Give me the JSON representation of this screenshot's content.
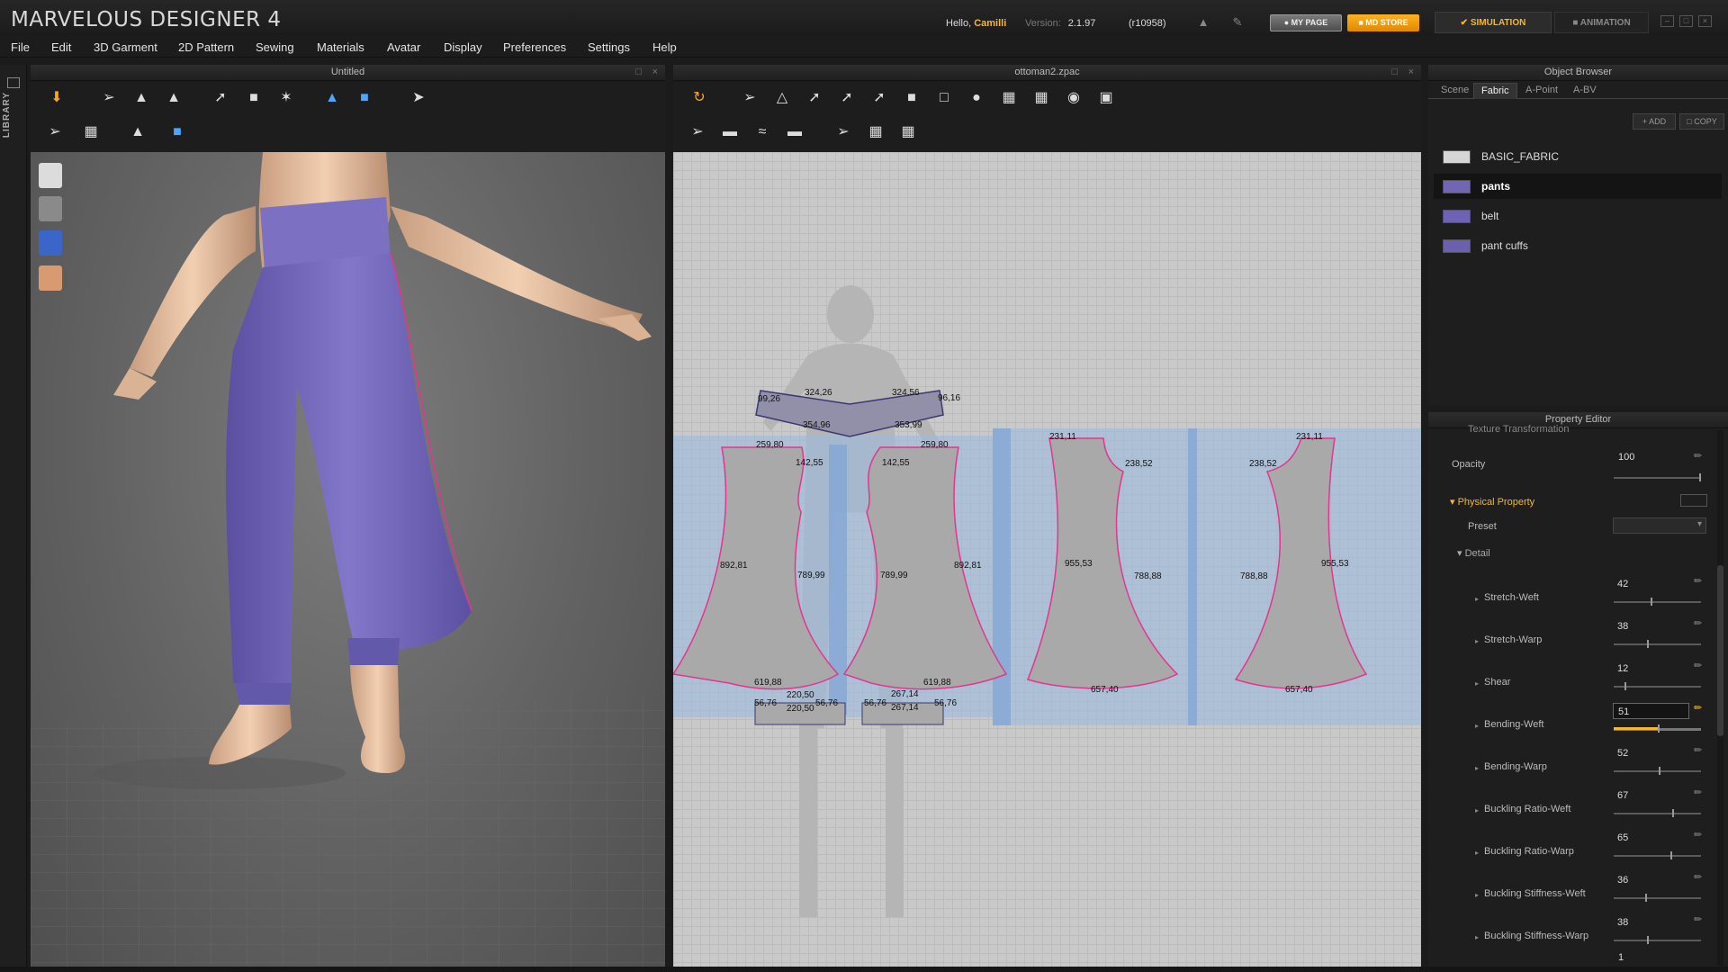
{
  "app": {
    "title": "MARVELOUS DESIGNER 4"
  },
  "header": {
    "hello_label": "Hello,",
    "user_name": "Camilli",
    "version_label": "Version:",
    "version_value": "2.1.97",
    "build": "(r10958)",
    "my_page": "MY PAGE",
    "md_store": "MD STORE",
    "mode_simulation": "SIMULATION",
    "mode_animation": "ANIMATION"
  },
  "menu": [
    "File",
    "Edit",
    "3D Garment",
    "2D Pattern",
    "Sewing",
    "Materials",
    "Avatar",
    "Display",
    "Preferences",
    "Settings",
    "Help"
  ],
  "library_label": "LIBRARY",
  "panels": {
    "view3d_title": "Untitled",
    "view2d_title": "ottoman2.zpac"
  },
  "pattern_labels": [
    "99,26",
    "324,26",
    "324,56",
    "96,16",
    "354,96",
    "353,99",
    "259,80",
    "142,55",
    "142,55",
    "259,80",
    "892,81",
    "789,99",
    "789,99",
    "892,81",
    "619,88",
    "619,88",
    "220,50",
    "220,50",
    "56,76",
    "56,76",
    "56,76",
    "267,14",
    "267,14",
    "56,76",
    "231,11",
    "238,52",
    "955,53",
    "788,88",
    "657,40",
    "231,11",
    "238,52",
    "788,88",
    "955,53",
    "657,40"
  ],
  "object_browser": {
    "title": "Object Browser",
    "tabs": [
      "Scene",
      "Fabric",
      "A-Point",
      "A-BV"
    ],
    "active_tab": "Fabric",
    "add_label": "ADD",
    "copy_label": "COPY",
    "fabrics": [
      {
        "name": "BASIC_FABRIC",
        "color": "#d6d6d6"
      },
      {
        "name": "pants",
        "color": "#7165b6"
      },
      {
        "name": "belt",
        "color": "#6d62b3"
      },
      {
        "name": "pant cuffs",
        "color": "#6b60b0"
      }
    ],
    "selected_fabric": "pants"
  },
  "property_editor": {
    "title": "Property Editor",
    "cut_label": "Texture Transformation",
    "opacity_label": "Opacity",
    "opacity_value": "100",
    "physical_property": "Physical Property",
    "preset_label": "Preset",
    "detail_label": "Detail",
    "properties": [
      {
        "label": "Stretch-Weft",
        "value": "42"
      },
      {
        "label": "Stretch-Warp",
        "value": "38"
      },
      {
        "label": "Shear",
        "value": "12"
      },
      {
        "label": "Bending-Weft",
        "value": "51"
      },
      {
        "label": "Bending-Warp",
        "value": "52"
      },
      {
        "label": "Buckling Ratio-Weft",
        "value": "67"
      },
      {
        "label": "Buckling Ratio-Warp",
        "value": "65"
      },
      {
        "label": "Buckling Stiffness-Weft",
        "value": "36"
      },
      {
        "label": "Buckling Stiffness-Warp",
        "value": "38"
      }
    ],
    "active_property": "Bending-Weft",
    "last_value": "1"
  },
  "colors": {
    "accent": "#f6b82b",
    "fabric_purple": "#6f63b3",
    "seam_pink": "#e4358f"
  }
}
